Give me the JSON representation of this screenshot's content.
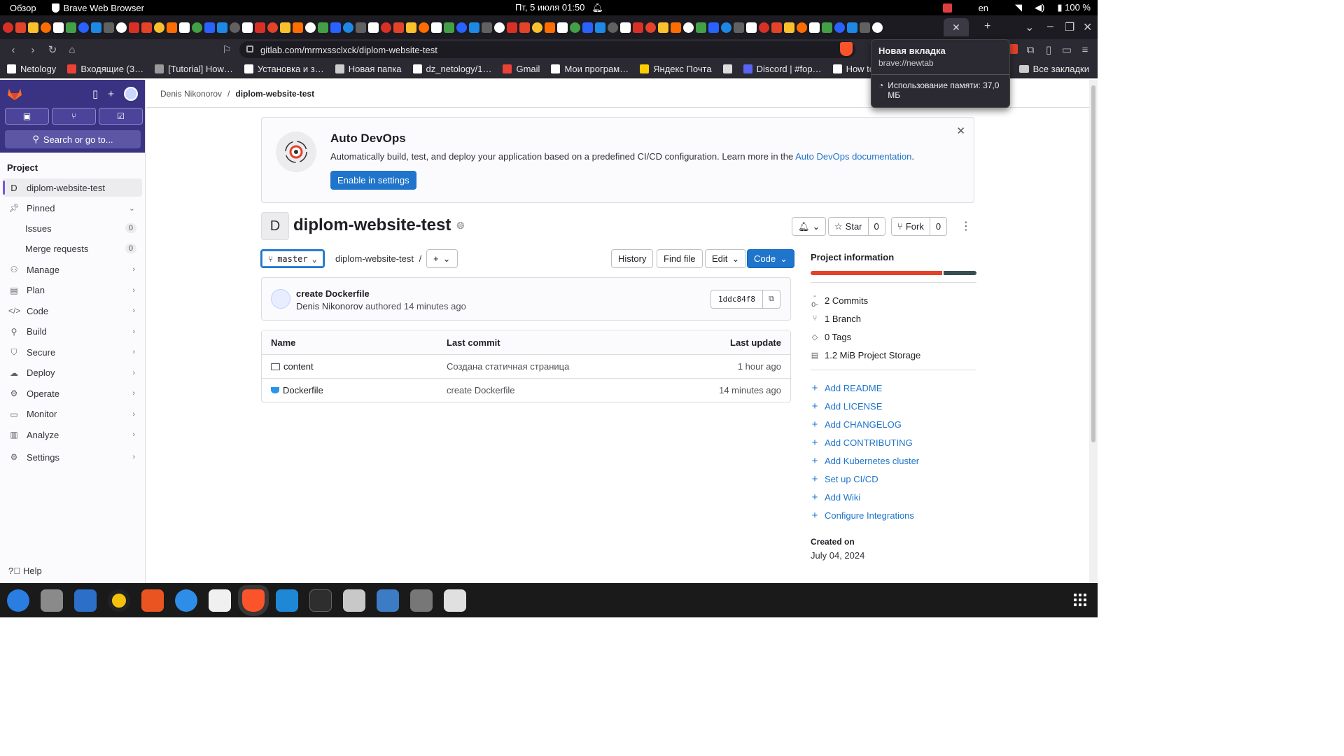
{
  "system_bar": {
    "overview": "Обзор",
    "app_name": "Brave Web Browser",
    "datetime": "Пт, 5 июля  01:50",
    "lang": "en",
    "battery": "100 %"
  },
  "browser": {
    "url": "gitlab.com/mrmxssclxck/diplom-website-test",
    "tooltip": {
      "title": "Новая вкладка",
      "url": "brave://newtab",
      "memory": "Использование памяти: 37,0 МБ"
    },
    "bookmarks": [
      {
        "label": "Netology",
        "color": "#ffffff"
      },
      {
        "label": "Входящие (3…",
        "color": "#ea4335"
      },
      {
        "label": "[Tutorial] How…",
        "color": "#999999"
      },
      {
        "label": "Установка и з…",
        "color": "#ffffff"
      },
      {
        "label": "Новая папка",
        "color": "#cccccc"
      },
      {
        "label": "dz_netology/1…",
        "color": "#ffffff"
      },
      {
        "label": "Gmail",
        "color": "#ea4335"
      },
      {
        "label": "Мои програм…",
        "color": "#ffffff"
      },
      {
        "label": "Яндекс Почта",
        "color": "#ffcc00"
      },
      {
        "label": "",
        "color": "#dddddd"
      },
      {
        "label": "Discord | #fop…",
        "color": "#5865f2"
      },
      {
        "label": "How to run an…",
        "color": "#ffffff"
      }
    ],
    "all_bookmarks": "Все закладки"
  },
  "sidebar": {
    "search": "Search or go to...",
    "section": "Project",
    "project_item": {
      "letter": "D",
      "label": "diplom-website-test"
    },
    "pinned": "Pinned",
    "pinned_items": [
      {
        "label": "Issues",
        "count": "0"
      },
      {
        "label": "Merge requests",
        "count": "0"
      }
    ],
    "menu": [
      {
        "label": "Manage",
        "icon": "users-icon",
        "glyph": "⚇"
      },
      {
        "label": "Plan",
        "icon": "calendar-icon",
        "glyph": "▤"
      },
      {
        "label": "Code",
        "icon": "code-icon",
        "glyph": "</>"
      },
      {
        "label": "Build",
        "icon": "rocket-icon",
        "glyph": "⚲"
      },
      {
        "label": "Secure",
        "icon": "shield-icon",
        "glyph": "⛉"
      },
      {
        "label": "Deploy",
        "icon": "deploy-icon",
        "glyph": "☁"
      },
      {
        "label": "Operate",
        "icon": "operate-icon",
        "glyph": "⚙"
      },
      {
        "label": "Monitor",
        "icon": "monitor-icon",
        "glyph": "▭"
      },
      {
        "label": "Analyze",
        "icon": "chart-icon",
        "glyph": "▥"
      }
    ],
    "settings": "Settings",
    "help": "Help"
  },
  "breadcrumb": {
    "owner": "Denis Nikonorov",
    "separator": "/",
    "project": "diplom-website-test"
  },
  "banner": {
    "title": "Auto DevOps",
    "text": "Automatically build, test, and deploy your application based on a predefined CI/CD configuration. Learn more in the",
    "link": "Auto DevOps documentation",
    "suffix": ".",
    "button": "Enable in settings"
  },
  "project": {
    "letter": "D",
    "name": "diplom-website-test",
    "star_label": "Star",
    "star_count": "0",
    "fork_label": "Fork",
    "fork_count": "0"
  },
  "toolbar": {
    "branch": "master",
    "path": "diplom-website-test",
    "path_sep": "/",
    "history": "History",
    "find_file": "Find file",
    "edit": "Edit",
    "code": "Code"
  },
  "last_commit": {
    "title": "create Dockerfile",
    "author": "Denis Nikonorov",
    "action": "authored 14 minutes ago",
    "sha": "1ddc84f8"
  },
  "file_table": {
    "headers": [
      "Name",
      "Last commit",
      "Last update"
    ],
    "rows": [
      {
        "name": "content",
        "type": "folder",
        "commit": "Создана статичная страница",
        "updated": "1 hour ago"
      },
      {
        "name": "Dockerfile",
        "type": "docker",
        "commit": "create Dockerfile",
        "updated": "14 minutes ago"
      }
    ]
  },
  "project_info": {
    "title": "Project information",
    "language_bar": [
      {
        "share": 0.8,
        "color": "#e24329"
      },
      {
        "share": 0.2,
        "color": "#384d54"
      }
    ],
    "stats": [
      {
        "label": "2 Commits",
        "icon": "commit-icon",
        "glyph": "-o-"
      },
      {
        "label": "1 Branch",
        "icon": "branch-icon",
        "glyph": "⑂"
      },
      {
        "label": "0 Tags",
        "icon": "tag-icon",
        "glyph": "◇"
      },
      {
        "label": "1.2 MiB Project Storage",
        "icon": "storage-icon",
        "glyph": "▤"
      }
    ],
    "links": [
      "Add README",
      "Add LICENSE",
      "Add CHANGELOG",
      "Add CONTRIBUTING",
      "Add Kubernetes cluster",
      "Set up CI/CD",
      "Add Wiki",
      "Configure Integrations"
    ],
    "created_label": "Created on",
    "created_date": "July 04, 2024"
  },
  "colors": {
    "gitlab_purple": "#3a3383",
    "link_blue": "#1f75cb",
    "gitlab_orange": "#e24329"
  }
}
